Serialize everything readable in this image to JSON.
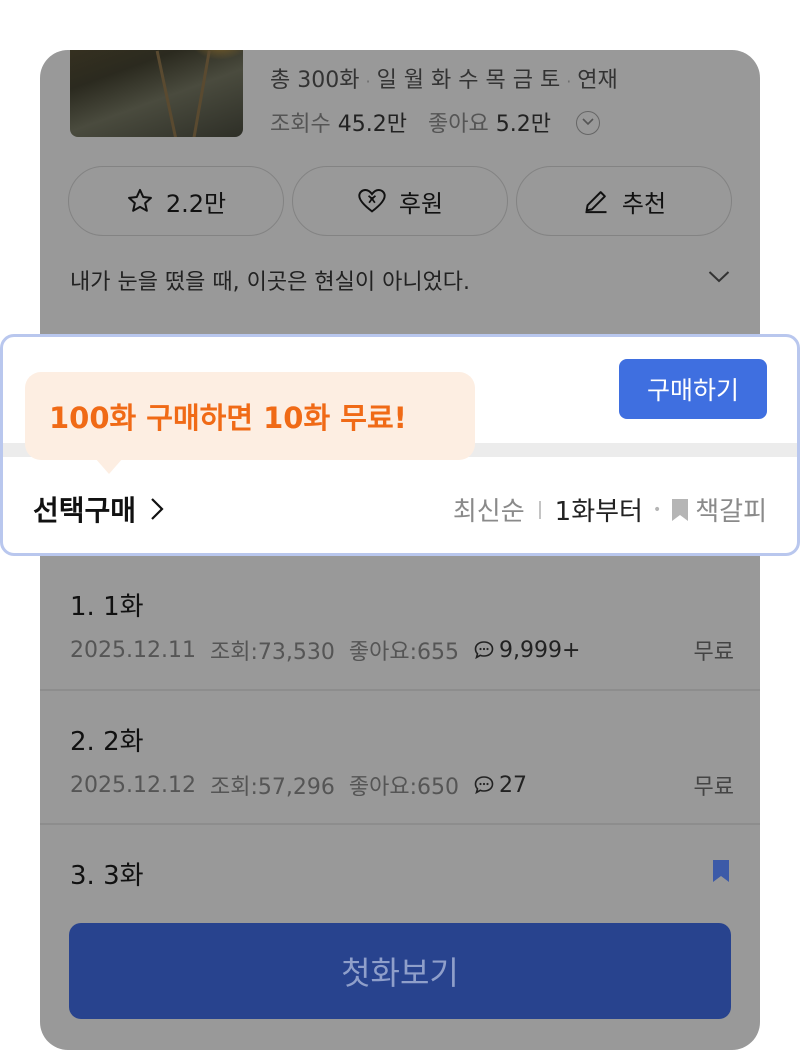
{
  "meta": {
    "total": "총 300화",
    "days": "일 월 화 수 목 금 토",
    "status": "연재",
    "views_label": "조회수",
    "views_value": "45.2만",
    "likes_label": "좋아요",
    "likes_value": "5.2만"
  },
  "actions": {
    "favorite": "2.2만",
    "support": "후원",
    "recommend": "추천"
  },
  "synopsis": "내가 눈을 떴을 때, 이곳은 현실이 아니었다.",
  "purchase": {
    "buy_label": "구매하기",
    "promo": "100화 구매하면 10화 무료!",
    "select_buy": "선택구매",
    "sort_latest": "최신순",
    "from_first": "1화부터",
    "bookmark": "책갈피"
  },
  "episodes": [
    {
      "title": "1. 1화",
      "date": "2025.12.11",
      "views": "조회:73,530",
      "likes": "좋아요:655",
      "comments": "9,999+",
      "price": "무료"
    },
    {
      "title": "2. 2화",
      "date": "2025.12.12",
      "views": "조회:57,296",
      "likes": "좋아요:650",
      "comments": "27",
      "price": "무료"
    },
    {
      "title": "3. 3화"
    }
  ],
  "first_view": "첫화보기",
  "colors": {
    "accent": "#3f6fe0",
    "promo_text": "#f06a16",
    "promo_bg": "#fdeee2",
    "overlay": "#999999",
    "first_button": "#28438e"
  }
}
